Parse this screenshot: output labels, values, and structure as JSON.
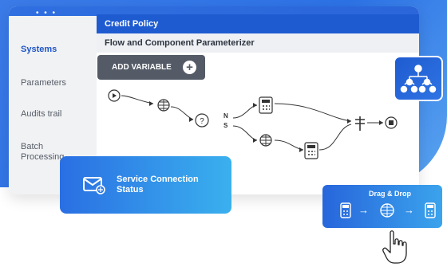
{
  "window": {
    "title": "Credit Policy",
    "subtitle": "Flow and Component Parameterizer"
  },
  "sidebar": {
    "items": [
      {
        "label": "Systems",
        "active": true
      },
      {
        "label": "Parameters",
        "active": false
      },
      {
        "label": "Audits trail",
        "active": false
      },
      {
        "label": "Batch Processing",
        "active": false
      }
    ]
  },
  "toolbar": {
    "add_variable_label": "ADD VARIABLE",
    "plus": "+"
  },
  "flow": {
    "branch_north": "N",
    "branch_south": "S",
    "decision_symbol": "?"
  },
  "service_card": {
    "label": "Service Connection Status"
  },
  "drag_drop": {
    "title": "Drag & Drop",
    "arrow": "→"
  },
  "colors": {
    "accent": "#1e5bd0",
    "gradient_light": "#3ab0ee",
    "button_dark": "#545b66"
  },
  "icons": [
    "tree-icon",
    "play-icon",
    "globe-icon",
    "decision-icon",
    "calculator-icon",
    "signpost-icon",
    "stop-icon",
    "envelope-icon",
    "hand-cursor-icon"
  ]
}
